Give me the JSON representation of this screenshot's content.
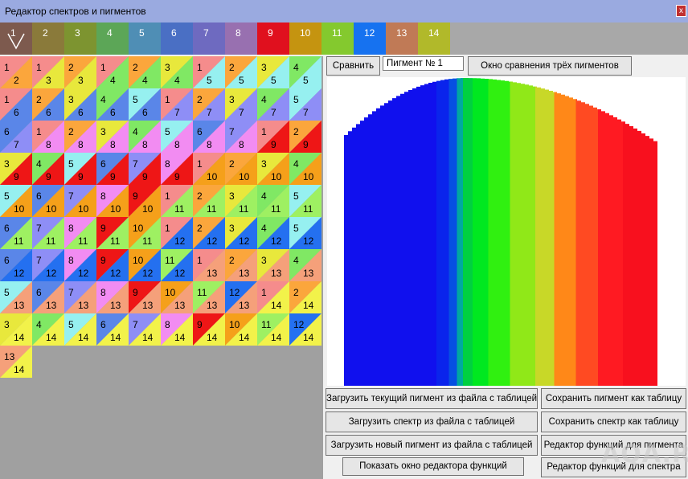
{
  "window": {
    "title": "Редактор спектров и пигментов",
    "close_label": "x"
  },
  "palette": {
    "first_label": "1",
    "tabs": [
      {
        "label": "1",
        "color": "#7d5a4e"
      },
      {
        "label": "2",
        "color": "#8a7a3a"
      },
      {
        "label": "3",
        "color": "#7d9430"
      },
      {
        "label": "4",
        "color": "#5ca657"
      },
      {
        "label": "5",
        "color": "#4f8eb5"
      },
      {
        "label": "6",
        "color": "#4a6fc4"
      },
      {
        "label": "7",
        "color": "#6e6ac0"
      },
      {
        "label": "8",
        "color": "#9870b0"
      },
      {
        "label": "9",
        "color": "#e0101e"
      },
      {
        "label": "10",
        "color": "#c59410"
      },
      {
        "label": "11",
        "color": "#84c92e"
      },
      {
        "label": "12",
        "color": "#1672f0"
      },
      {
        "label": "13",
        "color": "#c07a56"
      },
      {
        "label": "14",
        "color": "#b1b92a"
      }
    ]
  },
  "pigment_colors": {
    "1": "#f58c8c",
    "2": "#fba63c",
    "3": "#e8e83c",
    "4": "#80e864",
    "5": "#96f0f0",
    "6": "#5a86e8",
    "7": "#8e8ef6",
    "8": "#f28cf2",
    "9": "#ee1616",
    "10": "#f5a01a",
    "11": "#9ef062",
    "12": "#2470f0",
    "13": "#f5a07a",
    "14": "#f2f24a"
  },
  "mixture_cells": [
    {
      "a": "1",
      "b": "2"
    },
    {
      "a": "1",
      "b": "3"
    },
    {
      "a": "2",
      "b": "3"
    },
    {
      "a": "1",
      "b": "4"
    },
    {
      "a": "2",
      "b": "4"
    },
    {
      "a": "3",
      "b": "4"
    },
    {
      "a": "1",
      "b": "5"
    },
    {
      "a": "2",
      "b": "5"
    },
    {
      "a": "3",
      "b": "5"
    },
    {
      "a": "4",
      "b": "5"
    },
    {
      "a": "1",
      "b": "6"
    },
    {
      "a": "2",
      "b": "6"
    },
    {
      "a": "3",
      "b": "6"
    },
    {
      "a": "4",
      "b": "6"
    },
    {
      "a": "5",
      "b": "6"
    },
    {
      "a": "1",
      "b": "7"
    },
    {
      "a": "2",
      "b": "7"
    },
    {
      "a": "3",
      "b": "7"
    },
    {
      "a": "4",
      "b": "7"
    },
    {
      "a": "5",
      "b": "7"
    },
    {
      "a": "6",
      "b": "7"
    },
    {
      "a": "1",
      "b": "8"
    },
    {
      "a": "2",
      "b": "8"
    },
    {
      "a": "3",
      "b": "8"
    },
    {
      "a": "4",
      "b": "8"
    },
    {
      "a": "5",
      "b": "8"
    },
    {
      "a": "6",
      "b": "8"
    },
    {
      "a": "7",
      "b": "8"
    },
    {
      "a": "1",
      "b": "9"
    },
    {
      "a": "2",
      "b": "9"
    },
    {
      "a": "3",
      "b": "9"
    },
    {
      "a": "4",
      "b": "9"
    },
    {
      "a": "5",
      "b": "9"
    },
    {
      "a": "6",
      "b": "9"
    },
    {
      "a": "7",
      "b": "9"
    },
    {
      "a": "8",
      "b": "9"
    },
    {
      "a": "1",
      "b": "10"
    },
    {
      "a": "2",
      "b": "10"
    },
    {
      "a": "3",
      "b": "10"
    },
    {
      "a": "4",
      "b": "10"
    },
    {
      "a": "5",
      "b": "10"
    },
    {
      "a": "6",
      "b": "10"
    },
    {
      "a": "7",
      "b": "10"
    },
    {
      "a": "8",
      "b": "10"
    },
    {
      "a": "9",
      "b": "10"
    },
    {
      "a": "1",
      "b": "11"
    },
    {
      "a": "2",
      "b": "11"
    },
    {
      "a": "3",
      "b": "11"
    },
    {
      "a": "4",
      "b": "11"
    },
    {
      "a": "5",
      "b": "11"
    },
    {
      "a": "6",
      "b": "11"
    },
    {
      "a": "7",
      "b": "11"
    },
    {
      "a": "8",
      "b": "11"
    },
    {
      "a": "9",
      "b": "11"
    },
    {
      "a": "10",
      "b": "11"
    },
    {
      "a": "1",
      "b": "12"
    },
    {
      "a": "2",
      "b": "12"
    },
    {
      "a": "3",
      "b": "12"
    },
    {
      "a": "4",
      "b": "12"
    },
    {
      "a": "5",
      "b": "12"
    },
    {
      "a": "6",
      "b": "12"
    },
    {
      "a": "7",
      "b": "12"
    },
    {
      "a": "8",
      "b": "12"
    },
    {
      "a": "9",
      "b": "12"
    },
    {
      "a": "10",
      "b": "12"
    },
    {
      "a": "11",
      "b": "12"
    },
    {
      "a": "1",
      "b": "13"
    },
    {
      "a": "2",
      "b": "13"
    },
    {
      "a": "3",
      "b": "13"
    },
    {
      "a": "4",
      "b": "13"
    },
    {
      "a": "5",
      "b": "13"
    },
    {
      "a": "6",
      "b": "13"
    },
    {
      "a": "7",
      "b": "13"
    },
    {
      "a": "8",
      "b": "13"
    },
    {
      "a": "9",
      "b": "13"
    },
    {
      "a": "10",
      "b": "13"
    },
    {
      "a": "11",
      "b": "13"
    },
    {
      "a": "12",
      "b": "13"
    },
    {
      "a": "1",
      "b": "14"
    },
    {
      "a": "2",
      "b": "14"
    },
    {
      "a": "3",
      "b": "14"
    },
    {
      "a": "4",
      "b": "14"
    },
    {
      "a": "5",
      "b": "14"
    },
    {
      "a": "6",
      "b": "14"
    },
    {
      "a": "7",
      "b": "14"
    },
    {
      "a": "8",
      "b": "14"
    },
    {
      "a": "9",
      "b": "14"
    },
    {
      "a": "10",
      "b": "14"
    },
    {
      "a": "11",
      "b": "14"
    },
    {
      "a": "12",
      "b": "14"
    },
    {
      "a": "13",
      "b": "14"
    }
  ],
  "controls": {
    "compare_label": "Сравнить",
    "pigment_name_value": "Пигмент № 1",
    "compare_three_label": "Окно сравнения трёх пигментов"
  },
  "buttons": {
    "load_current_pigment": "Загрузить текущий пигмент из файла с таблицей",
    "save_pigment_table": "Сохранить пигмент как таблицу",
    "load_spectrum": "Загрузить спектр из файла с таблицей",
    "save_spectrum_table": "Сохранить спектр как таблицу",
    "load_new_pigment": "Загрузить новый пигмент из файла с таблицей",
    "pigment_func_editor": "Редактор функций для пигмента",
    "show_func_editor": "Показать окно редактора функций",
    "spectrum_func_editor": "Редактор функций для спектра"
  },
  "spectrum": {
    "colors": [
      "#1010ee",
      "#0a24ec",
      "#0650e2",
      "#00a8a0",
      "#00d040",
      "#00e820",
      "#30f010",
      "#90e818",
      "#c8d828",
      "#ff8818",
      "#ff4a22",
      "#ff1a22",
      "#f8101e"
    ],
    "band_fractions": [
      0.295,
      0.04,
      0.025,
      0.02,
      0.03,
      0.05,
      0.07,
      0.08,
      0.06,
      0.07,
      0.07,
      0.08,
      0.11
    ]
  },
  "watermark": "AQA.RU"
}
